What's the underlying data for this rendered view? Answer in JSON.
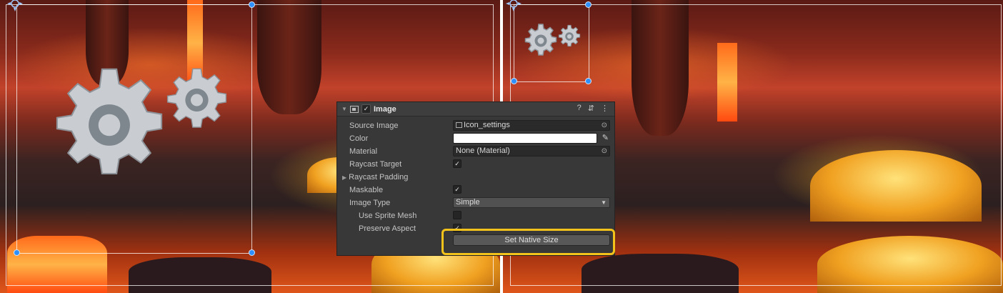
{
  "inspector": {
    "component_title": "Image",
    "header_icons": {
      "help": "?",
      "preset": "⇵",
      "menu": "⋮"
    },
    "rows": {
      "source_image": {
        "label": "Source Image",
        "value": "Icon_settings"
      },
      "color": {
        "label": "Color",
        "value": "#FFFFFF"
      },
      "material": {
        "label": "Material",
        "value": "None (Material)"
      },
      "raycast_target": {
        "label": "Raycast Target",
        "checked": true
      },
      "raycast_padding": {
        "label": "Raycast Padding"
      },
      "maskable": {
        "label": "Maskable",
        "checked": true
      },
      "image_type": {
        "label": "Image Type",
        "value": "Simple"
      },
      "use_sprite_mesh": {
        "label": "Use Sprite Mesh",
        "checked": false
      },
      "preserve_aspect": {
        "label": "Preserve Aspect",
        "checked": true
      }
    },
    "set_native_size_label": "Set Native Size"
  },
  "marks": {
    "check": "✓",
    "picker": "⊙",
    "eyedropper": "✎",
    "expand": "▶",
    "collapse": "▼",
    "dropdown_caret": "▼"
  },
  "colors": {
    "highlight": "#F3C21B",
    "handle": "#2E8FFF",
    "gear": "#C9CDD1"
  }
}
